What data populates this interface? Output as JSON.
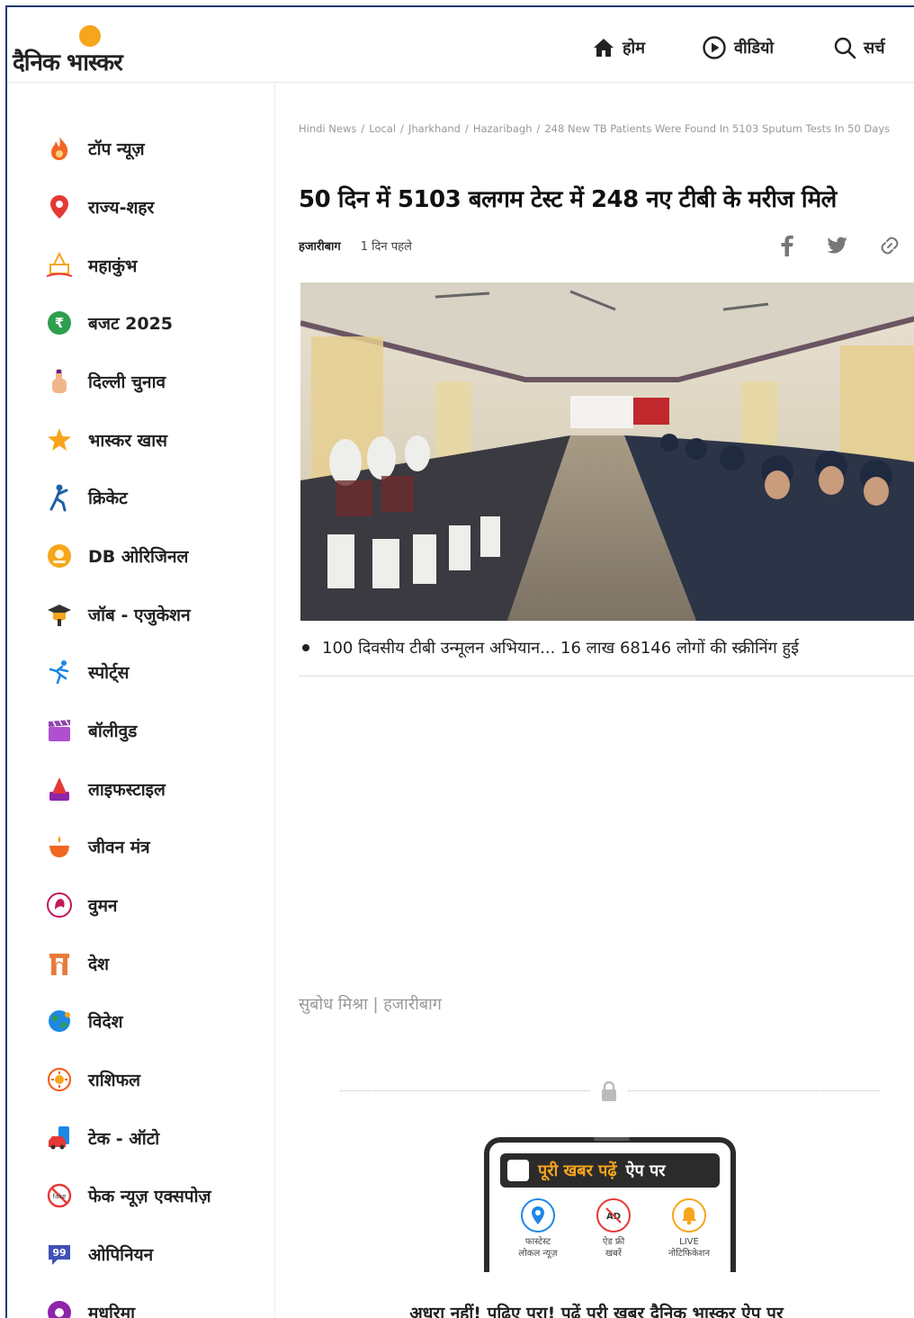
{
  "header": {
    "logo_text": "दैनिक भास्कर",
    "nav": [
      {
        "label": "होम",
        "icon": "home-icon"
      },
      {
        "label": "वीडियो",
        "icon": "play-circle-icon"
      },
      {
        "label": "सर्च",
        "icon": "search-icon"
      }
    ]
  },
  "sidebar": {
    "items": [
      {
        "label": "टॉप न्यूज़",
        "icon": "fire-icon",
        "color": "#f26522"
      },
      {
        "label": "राज्य-शहर",
        "icon": "location-pin-icon",
        "color": "#e53935"
      },
      {
        "label": "महाकुंभ",
        "icon": "temple-icon",
        "color": "#f7a51c"
      },
      {
        "label": "बजट 2025",
        "icon": "rupee-icon",
        "color": "#2e9e4f"
      },
      {
        "label": "दिल्ली चुनाव",
        "icon": "voting-finger-icon",
        "color": "#e87b3a"
      },
      {
        "label": "भास्कर खास",
        "icon": "star-icon",
        "color": "#f7a51c"
      },
      {
        "label": "क्रिकेट",
        "icon": "cricket-player-icon",
        "color": "#1f5fa8"
      },
      {
        "label": "DB ओरिजिनल",
        "icon": "db-original-icon",
        "color": "#f7a51c"
      },
      {
        "label": "जॉब - एजुकेशन",
        "icon": "graduation-icon",
        "color": "#333333"
      },
      {
        "label": "स्पोर्ट्स",
        "icon": "runner-icon",
        "color": "#1e88e5"
      },
      {
        "label": "बॉलीवुड",
        "icon": "clapperboard-icon",
        "color": "#8e44ad"
      },
      {
        "label": "लाइफस्टाइल",
        "icon": "lifestyle-icon",
        "color": "#e53935"
      },
      {
        "label": "जीवन मंत्र",
        "icon": "diya-icon",
        "color": "#f26522"
      },
      {
        "label": "वुमन",
        "icon": "woman-icon",
        "color": "#c2185b"
      },
      {
        "label": "देश",
        "icon": "india-gate-icon",
        "color": "#e87b3a"
      },
      {
        "label": "विदेश",
        "icon": "globe-icon",
        "color": "#1e88e5"
      },
      {
        "label": "राशिफल",
        "icon": "zodiac-icon",
        "color": "#f26522"
      },
      {
        "label": "टेक - ऑटो",
        "icon": "tech-auto-icon",
        "color": "#1e88e5"
      },
      {
        "label": "फेक न्यूज़ एक्सपोज़",
        "icon": "fake-news-icon",
        "color": "#e53935"
      },
      {
        "label": "ओपिनियन",
        "icon": "opinion-icon",
        "color": "#3f51b5"
      },
      {
        "label": "मधुरिमा",
        "icon": "madhurima-icon",
        "color": "#8e24aa"
      }
    ]
  },
  "article": {
    "breadcrumb": [
      "Hindi News",
      "Local",
      "Jharkhand",
      "Hazaribagh",
      "248 New TB Patients Were Found In 5103 Sputum Tests In 50 Days"
    ],
    "headline": "50 दिन में 5103 बलगम टेस्ट में 248 नए टीबी के मरीज मिले",
    "location": "हजारीबाग",
    "time_ago": "1 दिन पहले",
    "share_icons": [
      "facebook-icon",
      "twitter-icon",
      "link-icon"
    ],
    "caption": "100 दिवसीय टीबी उन्मूलन अभियान... 16 लाख 68146 लोगों की स्क्रीनिंग हुई",
    "byline": "सुबोध मिश्रा | हजारीबाग"
  },
  "promo": {
    "title_highlight": "पूरी खबर पढ़ें",
    "title_rest": "ऐप पर",
    "features": [
      {
        "label_line1": "फास्टेस्ट",
        "label_line2": "लोकल न्यूज़",
        "icon": "location-icon",
        "color": "#1e88e5"
      },
      {
        "label_line1": "ऐड फ्री",
        "label_line2": "खबरें",
        "icon": "ad-free-icon",
        "color": "#e53935"
      },
      {
        "label_line1": "LIVE",
        "label_line2": "नोटिफिकेशन",
        "icon": "bell-icon",
        "color": "#f7a51c"
      }
    ],
    "cta": "अधूरा नहीं! पढ़िए पूरा! पढ़ें पूरी खबर दैनिक भास्कर ऐप पर"
  }
}
